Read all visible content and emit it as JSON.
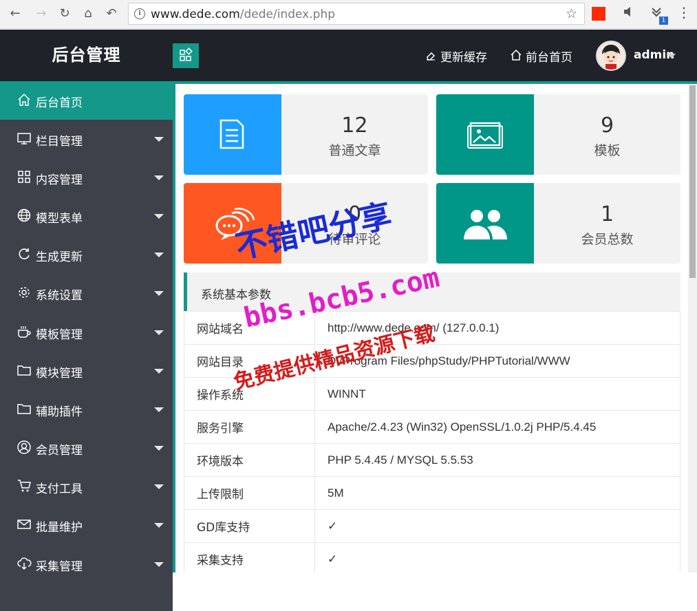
{
  "browser": {
    "url_host": "www.dede.com",
    "url_path": "/dede/index.php",
    "ext_badge": "1"
  },
  "header": {
    "title": "后台管理",
    "refresh_cache": "更新缓存",
    "front_home": "前台首页",
    "user_name": "admin"
  },
  "sidebar": {
    "items": [
      {
        "label": "后台首页",
        "icon": "home-icon"
      },
      {
        "label": "栏目管理",
        "icon": "monitor-icon"
      },
      {
        "label": "内容管理",
        "icon": "grid-icon"
      },
      {
        "label": "模型表单",
        "icon": "globe-icon"
      },
      {
        "label": "生成更新",
        "icon": "refresh-icon"
      },
      {
        "label": "系统设置",
        "icon": "gear-icon"
      },
      {
        "label": "模板管理",
        "icon": "coffee-icon"
      },
      {
        "label": "模块管理",
        "icon": "folder-icon"
      },
      {
        "label": "辅助插件",
        "icon": "folder-icon"
      },
      {
        "label": "会员管理",
        "icon": "user-icon"
      },
      {
        "label": "支付工具",
        "icon": "cart-icon"
      },
      {
        "label": "批量维护",
        "icon": "mail-icon"
      },
      {
        "label": "采集管理",
        "icon": "cloud-download-icon"
      }
    ]
  },
  "stats": [
    {
      "value": "12",
      "label": "普通文章",
      "color": "#1e9fff",
      "icon": "document-icon"
    },
    {
      "value": "9",
      "label": "模板",
      "color": "#009688",
      "icon": "image-icon"
    },
    {
      "value": "0",
      "label": "待审评论",
      "color": "#ff5722",
      "icon": "chat-icon"
    },
    {
      "value": "1",
      "label": "会员总数",
      "color": "#009688",
      "icon": "users-icon"
    }
  ],
  "system": {
    "title": "系统基本参数",
    "rows": [
      {
        "key": "网站域名",
        "value": "http://www.dede.com/ (127.0.0.1)"
      },
      {
        "key": "网站目录",
        "value": "D:/Program Files/phpStudy/PHPTutorial/WWW"
      },
      {
        "key": "操作系统",
        "value": "WINNT"
      },
      {
        "key": "服务引擎",
        "value": "Apache/2.4.23 (Win32) OpenSSL/1.0.2j PHP/5.4.45"
      },
      {
        "key": "环境版本",
        "value": "PHP 5.4.45 / MYSQL 5.5.53"
      },
      {
        "key": "上传限制",
        "value": "5M"
      },
      {
        "key": "GD库支持",
        "value": "✓"
      },
      {
        "key": "采集支持",
        "value": "✓"
      }
    ]
  },
  "watermark": {
    "line1": "不错吧分享",
    "line2": "bbs.bcb5.com",
    "line3": "免费提供精品资源下载"
  },
  "colors": {
    "accent": "#14988a",
    "header_bg": "#1f2329",
    "sidebar_bg": "#3e414a"
  }
}
